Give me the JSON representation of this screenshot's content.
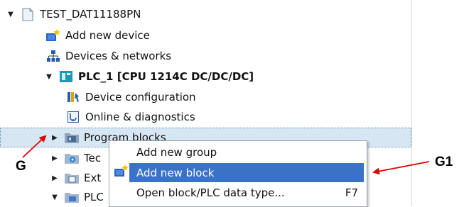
{
  "tree": {
    "project": {
      "label": "TEST_DAT11188PN",
      "icon": "project-page-icon"
    },
    "add_new_device": {
      "label": "Add new device",
      "icon": "add-device-icon"
    },
    "devices_networks": {
      "label": "Devices & networks",
      "icon": "network-icon"
    },
    "plc": {
      "label": "PLC_1 [CPU 1214C DC/DC/DC]",
      "icon": "plc-icon"
    },
    "device_configuration": {
      "label": "Device configuration",
      "icon": "device-config-icon"
    },
    "online_diagnostics": {
      "label": "Online & diagnostics",
      "icon": "diagnostics-icon"
    },
    "program_blocks": {
      "label": "Program blocks",
      "icon": "folder-blocks-icon"
    },
    "technology_objects": {
      "label": "Tec",
      "icon": "folder-tech-icon"
    },
    "external_sources": {
      "label": "Ext",
      "icon": "folder-ext-icon"
    },
    "plc_tags": {
      "label": "PLC",
      "icon": "folder-plc-icon"
    }
  },
  "context_menu": {
    "items": [
      {
        "label": "Add new group",
        "shortcut": ""
      },
      {
        "label": "Add new block",
        "shortcut": ""
      },
      {
        "label": "Open block/PLC data type...",
        "shortcut": "F7"
      }
    ]
  },
  "callouts": {
    "left": "G",
    "right": "G1"
  },
  "colors": {
    "selection": "#d7e6f3",
    "menu_highlight": "#3a72c7",
    "callout_arrow": "#e00000"
  }
}
